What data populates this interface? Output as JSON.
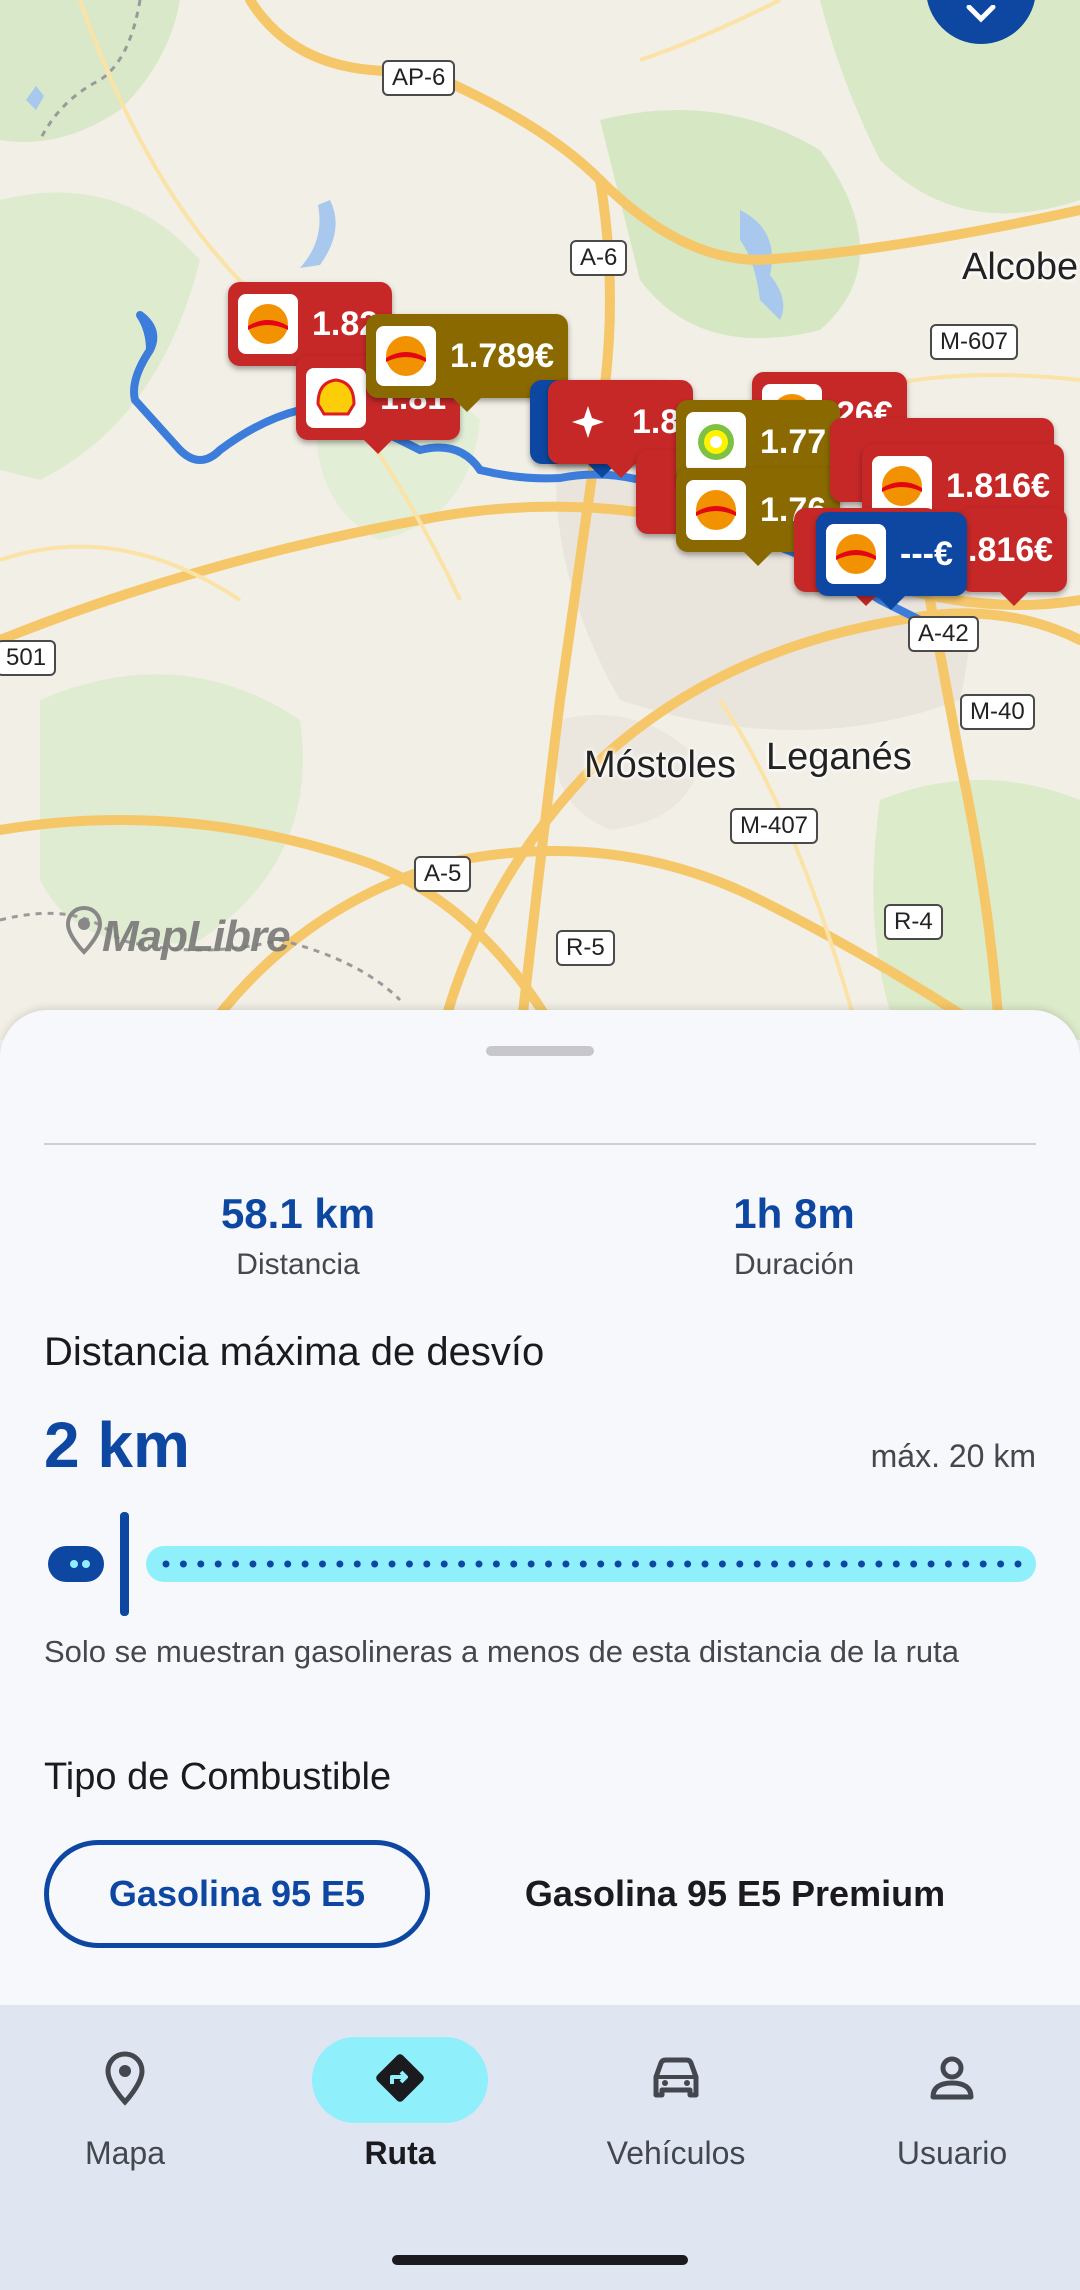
{
  "map": {
    "road_labels": [
      "AP-6",
      "A-6",
      "M-607",
      "A-42",
      "M-40",
      "M-407",
      "A-5",
      "R-5",
      "R-4",
      "501"
    ],
    "city_labels": [
      "Alcobe",
      "Móstoles",
      "Leganés"
    ],
    "attribution": "MapLibre",
    "markers": [
      {
        "price": "1.82",
        "brand": "repsol",
        "color": "red"
      },
      {
        "price": "1.81",
        "brand": "shell",
        "color": "red"
      },
      {
        "price": "1.789€",
        "brand": "repsol",
        "color": "gold"
      },
      {
        "price": "1.8",
        "brand": "cepsa",
        "color": "red"
      },
      {
        "price": "26€",
        "brand": "repsol",
        "color": "red"
      },
      {
        "price": "1.77",
        "brand": "bp",
        "color": "gold"
      },
      {
        "price": "1.76",
        "brand": "repsol",
        "color": "gold"
      },
      {
        "price": "1.816€",
        "brand": "repsol",
        "color": "red"
      },
      {
        "price": ".816€",
        "brand": "repsol",
        "color": "red"
      },
      {
        "price": "---€",
        "brand": "repsol",
        "color": "blue"
      }
    ]
  },
  "route": {
    "distance_value": "58.1 km",
    "distance_label": "Distancia",
    "duration_value": "1h 8m",
    "duration_label": "Duración"
  },
  "detour": {
    "title": "Distancia máxima de desvío",
    "value": "2 km",
    "max_label": "máx. 20 km",
    "fraction": 0.1,
    "helper": "Solo se muestran gasolineras a menos de esta distancia de la ruta"
  },
  "fuel": {
    "title": "Tipo de Combustible",
    "options": [
      "Gasolina 95 E5",
      "Gasolina 95 E5 Premium"
    ],
    "selected": "Gasolina 95 E5"
  },
  "nav": {
    "items": [
      {
        "label": "Mapa",
        "icon": "map-pin-icon"
      },
      {
        "label": "Ruta",
        "icon": "directions-icon"
      },
      {
        "label": "Vehículos",
        "icon": "car-icon"
      },
      {
        "label": "Usuario",
        "icon": "person-icon"
      }
    ],
    "active": "Ruta"
  },
  "colors": {
    "primary": "#0d47a1",
    "accent": "#8ff0fb",
    "marker_red": "#c62828",
    "marker_gold": "#8a6a00"
  }
}
